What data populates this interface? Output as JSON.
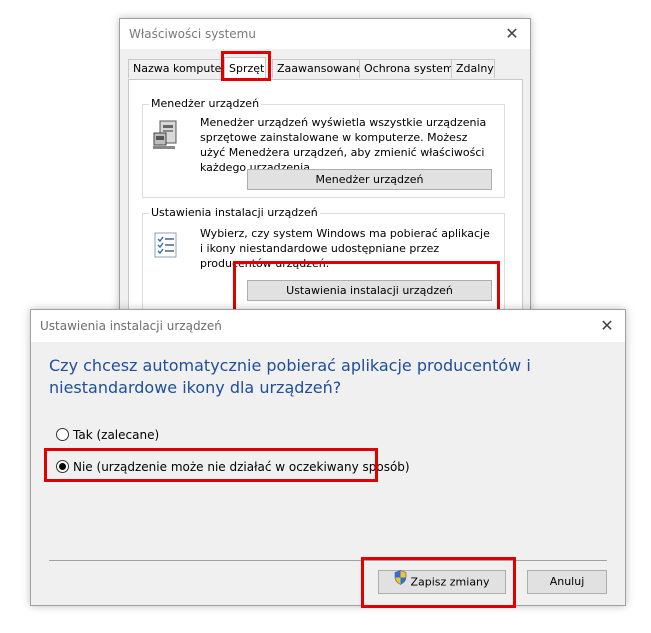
{
  "system_properties": {
    "title": "Właściwości systemu",
    "tabs": [
      {
        "label": "Nazwa komputera"
      },
      {
        "label": "Sprzęt"
      },
      {
        "label": "Zaawansowane"
      },
      {
        "label": "Ochrona systemu"
      },
      {
        "label": "Zdalny"
      }
    ],
    "device_manager": {
      "title": "Menedżer urządzeń",
      "description": "Menedżer urządzeń wyświetla wszystkie urządzenia sprzętowe zainstalowane w komputerze. Możesz użyć Menedżera urządzeń, aby zmienić właściwości każdego urządzenia.",
      "button_label": "Menedżer urządzeń"
    },
    "device_installation": {
      "title": "Ustawienia instalacji urządzeń",
      "description": "Wybierz, czy system Windows ma pobierać aplikacje i ikony niestandardowe udostępniane przez producentów urządzeń.",
      "button_label": "Ustawienia instalacji urządzeń"
    }
  },
  "dialog": {
    "title": "Ustawienia instalacji urządzeń",
    "question": "Czy chcesz automatycznie pobierać aplikacje producentów i niestandardowe ikony dla urządzeń?",
    "options": [
      {
        "label": "Tak (zalecane)",
        "selected": false
      },
      {
        "label": "Nie (urządzenie może nie działać w oczekiwany sposób)",
        "selected": true
      }
    ],
    "save_label": "Zapisz zmiany",
    "cancel_label": "Anuluj"
  },
  "colors": {
    "highlight": "#e00000",
    "question_text": "#1e4e9c"
  }
}
